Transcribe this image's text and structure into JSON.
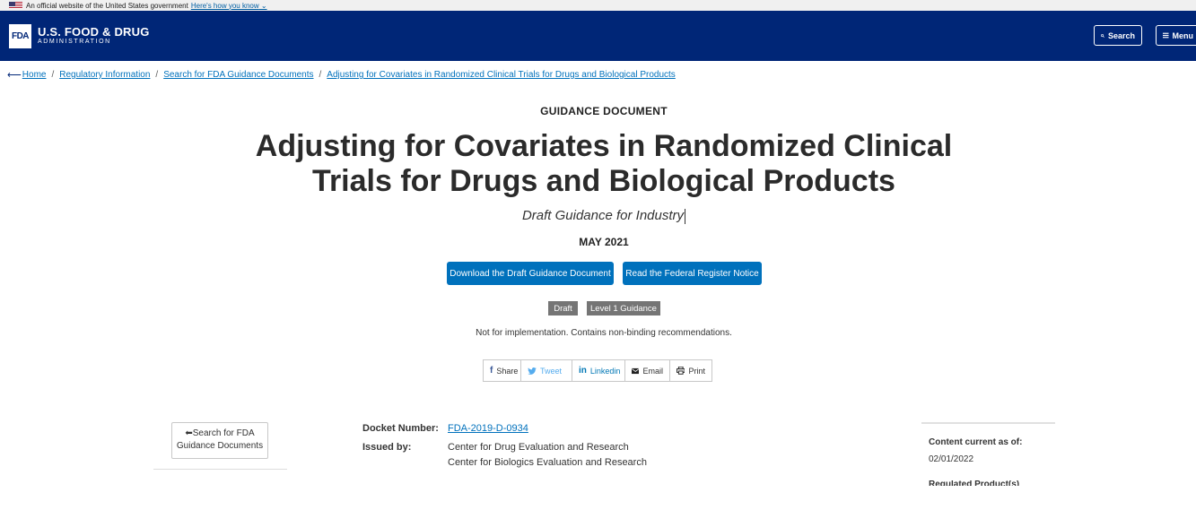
{
  "gov_banner": {
    "text": "An official website of the United States government",
    "link": "Here's how you know"
  },
  "header": {
    "logo_mark": "FDA",
    "logo_line1": "U.S. FOOD & DRUG",
    "logo_line2": "ADMINISTRATION",
    "search_label": "Search",
    "menu_label": "Menu",
    "color": "#002677"
  },
  "breadcrumb": [
    {
      "label": "Home"
    },
    {
      "label": "Regulatory Information"
    },
    {
      "label": "Search for FDA Guidance Documents"
    },
    {
      "label": "Adjusting for Covariates in Randomized Clinical Trials for Drugs and Biological Products"
    }
  ],
  "doc": {
    "eyebrow": "GUIDANCE DOCUMENT",
    "title_line1": "Adjusting for Covariates in Randomized Clinical",
    "title_line2": "Trials for Drugs and Biological Products",
    "subtitle": "Draft Guidance for Industry",
    "date": "MAY 2021",
    "download_label": "Download the Draft Guidance Document",
    "federal_label": "Read the Federal Register Notice",
    "tags": [
      "Draft",
      "Level 1 Guidance"
    ],
    "note": "Not for implementation. Contains non-binding recommendations."
  },
  "share": {
    "facebook": "Share",
    "twitter": "Tweet",
    "linkedin": "Linkedin",
    "email": "Email",
    "print": "Print"
  },
  "sidebar": {
    "search_line1": "Search for FDA",
    "search_line2": "Guidance Documents"
  },
  "meta": {
    "docket_label": "Docket Number:",
    "docket_value": "FDA-2019-D-0934",
    "issued_label": "Issued by:",
    "issued_value1": "Center for Drug Evaluation and Research",
    "issued_value2": "Center for Biologics Evaluation and Research"
  },
  "right": {
    "content_label": "Content current as of:",
    "content_date": "02/01/2022",
    "related_label": "Regulated Product(s)"
  },
  "colors": {
    "primary_button": "#0071bc",
    "tag": "#757575"
  }
}
